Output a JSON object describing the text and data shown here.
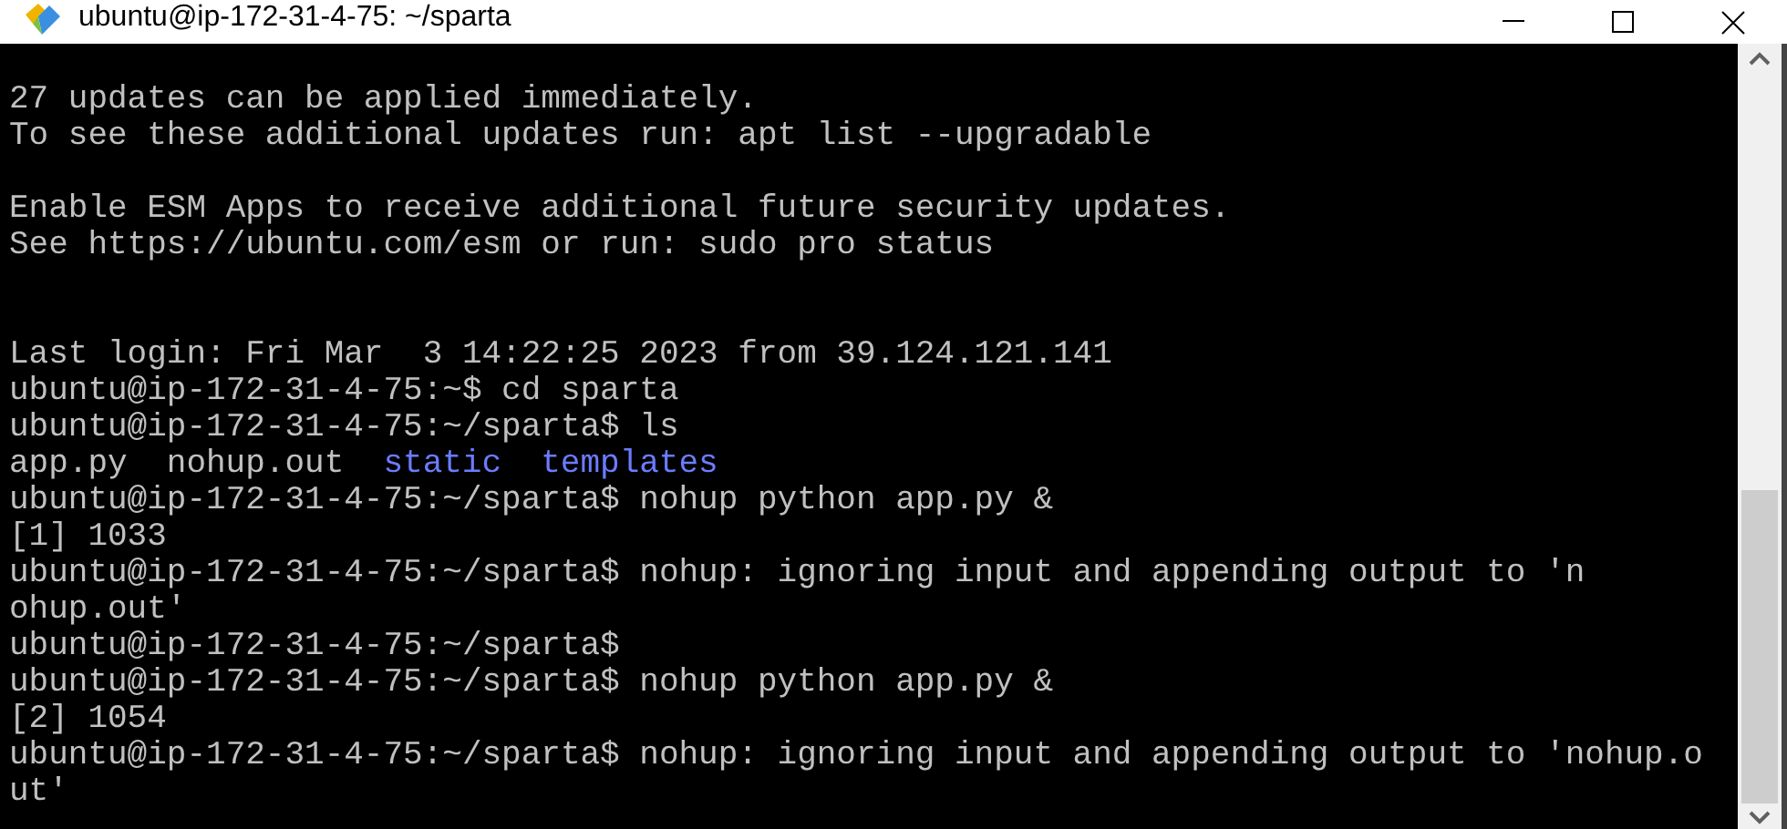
{
  "window": {
    "title": "ubuntu@ip-172-31-4-75: ~/sparta"
  },
  "terminal": {
    "lines": [
      {
        "kind": "blank"
      },
      {
        "kind": "text",
        "segments": [
          {
            "text": "27 updates can be applied immediately.",
            "kind": "plain"
          }
        ]
      },
      {
        "kind": "text",
        "segments": [
          {
            "text": "To see these additional updates run: apt list --upgradable",
            "kind": "plain"
          }
        ]
      },
      {
        "kind": "blank"
      },
      {
        "kind": "text",
        "segments": [
          {
            "text": "Enable ESM Apps to receive additional future security updates.",
            "kind": "plain"
          }
        ]
      },
      {
        "kind": "text",
        "segments": [
          {
            "text": "See https://ubuntu.com/esm or run: sudo pro status",
            "kind": "plain"
          }
        ]
      },
      {
        "kind": "blank"
      },
      {
        "kind": "blank"
      },
      {
        "kind": "text",
        "segments": [
          {
            "text": "Last login: Fri Mar  3 14:22:25 2023 from 39.124.121.141",
            "kind": "plain"
          }
        ]
      },
      {
        "kind": "text",
        "segments": [
          {
            "text": "ubuntu@ip-172-31-4-75:~$ cd sparta",
            "kind": "plain"
          }
        ]
      },
      {
        "kind": "text",
        "segments": [
          {
            "text": "ubuntu@ip-172-31-4-75:~/sparta$ ls",
            "kind": "plain"
          }
        ]
      },
      {
        "kind": "listing",
        "segments": [
          {
            "text": "app.py",
            "kind": "plain"
          },
          {
            "text": "nohup.out",
            "kind": "plain"
          },
          {
            "text": "static",
            "kind": "directory"
          },
          {
            "text": "templates",
            "kind": "directory"
          }
        ]
      },
      {
        "kind": "text",
        "segments": [
          {
            "text": "ubuntu@ip-172-31-4-75:~/sparta$ nohup python app.py &",
            "kind": "plain"
          }
        ]
      },
      {
        "kind": "text",
        "segments": [
          {
            "text": "[1] 1033",
            "kind": "plain"
          }
        ]
      },
      {
        "kind": "text",
        "segments": [
          {
            "text": "ubuntu@ip-172-31-4-75:~/sparta$ nohup: ignoring input and appending output to 'n",
            "kind": "plain"
          }
        ]
      },
      {
        "kind": "text",
        "segments": [
          {
            "text": "ohup.out'",
            "kind": "plain"
          }
        ]
      },
      {
        "kind": "text",
        "segments": [
          {
            "text": "ubuntu@ip-172-31-4-75:~/sparta$",
            "kind": "plain"
          }
        ]
      },
      {
        "kind": "text",
        "segments": [
          {
            "text": "ubuntu@ip-172-31-4-75:~/sparta$ nohup python app.py &",
            "kind": "plain"
          }
        ]
      },
      {
        "kind": "text",
        "segments": [
          {
            "text": "[2] 1054",
            "kind": "plain"
          }
        ]
      },
      {
        "kind": "text",
        "segments": [
          {
            "text": "ubuntu@ip-172-31-4-75:~/sparta$ nohup: ignoring input and appending output to 'nohup.o",
            "kind": "plain"
          }
        ]
      },
      {
        "kind": "text",
        "segments": [
          {
            "text": "ut'",
            "kind": "plain"
          }
        ]
      }
    ]
  }
}
